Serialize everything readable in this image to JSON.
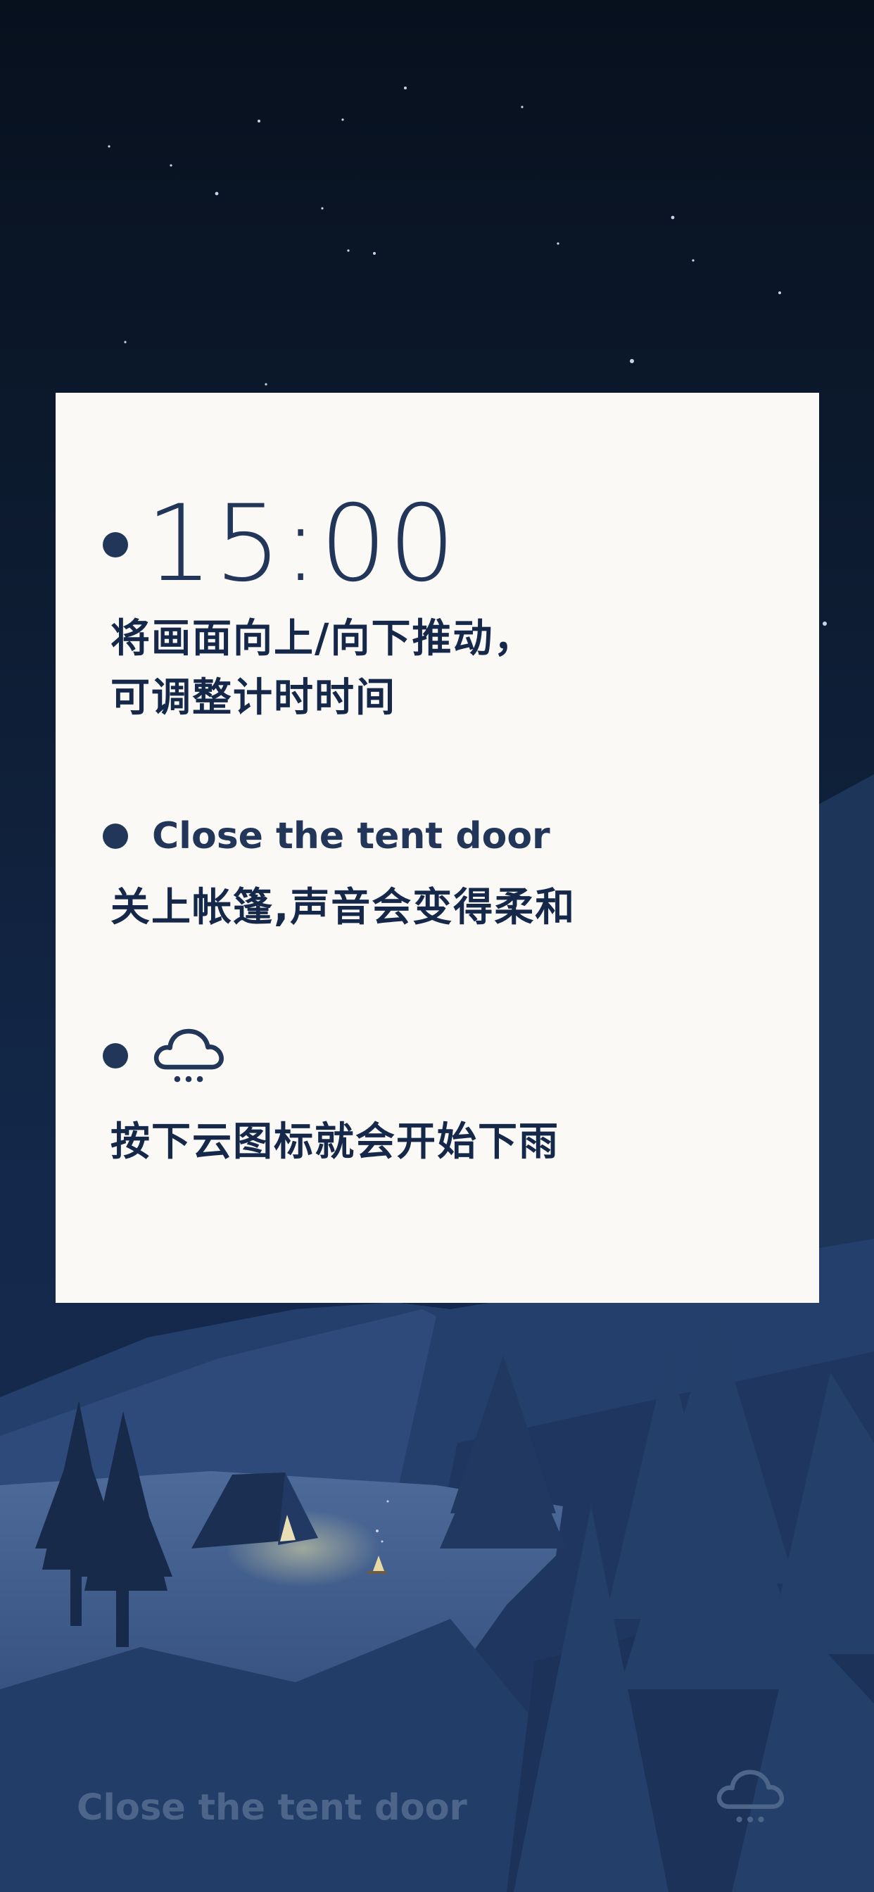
{
  "tutorial": {
    "time": "15:00",
    "time_hint": "将画面向上/向下推动，\n可调整计时时间",
    "tent_title": "Close the tent door",
    "tent_hint": "关上帐篷,声音会变得柔和",
    "rain_icon": "rain-cloud-icon",
    "rain_hint": "按下云图标就会开始下雨"
  },
  "bottom_bar": {
    "tent_button_label": "Close the tent door",
    "rain_button_icon": "rain-cloud-icon"
  },
  "colors": {
    "card_background": "#faf9f6",
    "card_text": "#22365a",
    "bottom_label": "#4d6588",
    "sky_top": "#07101d",
    "sky_bottom": "#162c50"
  }
}
